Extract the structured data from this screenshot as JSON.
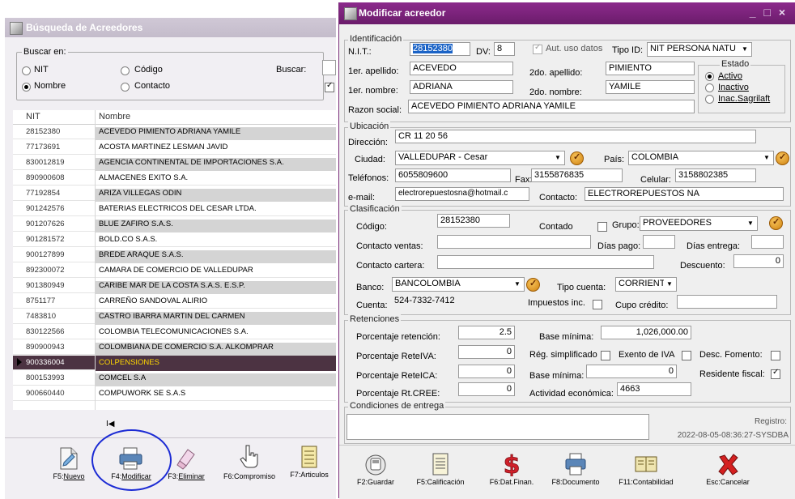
{
  "left_window": {
    "title": "Búsqueda de Acreedores",
    "search_in_label": "Buscar en:",
    "radio_nit": "NIT",
    "radio_codigo": "Código",
    "radio_nombre": "Nombre",
    "radio_contacto": "Contacto",
    "buscar_label": "Buscar:",
    "selected_radio": "Nombre",
    "columns": [
      "NIT",
      "Nombre"
    ],
    "rows": [
      {
        "nit": "28152380",
        "nombre": "ACEVEDO PIMIENTO ADRIANA YAMILE"
      },
      {
        "nit": "77173691",
        "nombre": "ACOSTA MARTINEZ LESMAN JAVID"
      },
      {
        "nit": "830012819",
        "nombre": "AGENCIA CONTINENTAL DE IMPORTACIONES S.A."
      },
      {
        "nit": "890900608",
        "nombre": "ALMACENES EXITO S.A."
      },
      {
        "nit": "77192854",
        "nombre": "ARIZA VILLEGAS ODIN"
      },
      {
        "nit": "901242576",
        "nombre": "BATERIAS ELECTRICOS DEL CESAR LTDA."
      },
      {
        "nit": "901207626",
        "nombre": "BLUE ZAFIRO S.A.S."
      },
      {
        "nit": "901281572",
        "nombre": "BOLD.CO S.A.S."
      },
      {
        "nit": "900127899",
        "nombre": "BREDE ARAQUE S.A.S."
      },
      {
        "nit": "892300072",
        "nombre": "CAMARA DE COMERCIO DE VALLEDUPAR"
      },
      {
        "nit": "901380949",
        "nombre": "CARIBE MAR DE LA COSTA S.A.S. E.S.P."
      },
      {
        "nit": "8751177",
        "nombre": "CARREÑO SANDOVAL ALIRIO"
      },
      {
        "nit": "7483810",
        "nombre": "CASTRO IBARRA MARTIN DEL CARMEN"
      },
      {
        "nit": "830122566",
        "nombre": "COLOMBIA TELECOMUNICACIONES S.A."
      },
      {
        "nit": "890900943",
        "nombre": "COLOMBIANA DE COMERCIO S.A.   ALKOMPRAR"
      },
      {
        "nit": "900336004",
        "nombre": "COLPENSIONES"
      },
      {
        "nit": "800153993",
        "nombre": "COMCEL S.A"
      },
      {
        "nit": "900660440",
        "nombre": "COMPUWORK SE  S.A.S"
      }
    ],
    "selected_row_index": 15,
    "nav_glyph": "I◀",
    "toolbar": [
      {
        "key": "F5:",
        "label": "Nuevo",
        "icon": "new-document-icon"
      },
      {
        "key": "F4:",
        "label": "Modificar",
        "icon": "printer-edit-icon"
      },
      {
        "key": "F3:",
        "label": "Eliminar",
        "icon": "eraser-icon"
      },
      {
        "key": "F6:",
        "label": "Compromiso",
        "icon": "hand-pointer-icon"
      },
      {
        "key": "F7:",
        "label": "Articulos",
        "icon": "articles-list-icon"
      }
    ]
  },
  "right_window": {
    "title": "Modificar acreedor",
    "window_buttons": "_ □ ×",
    "identificacion": {
      "legend": "Identificación",
      "nit_label": "N.I.T.:",
      "nit": "28152380",
      "dv_label": "DV:",
      "dv": "8",
      "aut_label": "Aut. uso datos",
      "tipo_id_label": "Tipo ID:",
      "tipo_id": "NIT PERSONA NATU",
      "apellido1_label": "1er. apellido:",
      "apellido1": "ACEVEDO",
      "apellido2_label": "2do. apellido:",
      "apellido2": "PIMIENTO",
      "nombre1_label": "1er. nombre:",
      "nombre1": "ADRIANA",
      "nombre2_label": "2do. nombre:",
      "nombre2": "YAMILE",
      "razon_label": "Razon social:",
      "razon": "ACEVEDO PIMIENTO ADRIANA YAMILE",
      "estado_legend": "Estado",
      "estado_activo": "Activo",
      "estado_inactivo": "Inactivo",
      "estado_inac_sagrilaft": "Inac.Sagrilaft"
    },
    "ubicacion": {
      "legend": "Ubicación",
      "direccion_label": "Dirección:",
      "direccion": "CR 11 20 56",
      "ciudad_label": "Ciudad:",
      "ciudad": "VALLEDUPAR - Cesar",
      "pais_label": "País:",
      "pais": "COLOMBIA",
      "telefonos_label": "Teléfonos:",
      "telefonos": "6055809600",
      "fax_label": "Fax:",
      "fax": "3155876835",
      "celular_label": "Celular:",
      "celular": "3158802385",
      "email_label": "e-mail:",
      "email": "electrorepuestosna@hotmail.c",
      "contacto_label": "Contacto:",
      "contacto": "ELECTROREPUESTOS NA"
    },
    "clasificacion": {
      "legend": "Clasificación",
      "codigo_label": "Código:",
      "codigo": "28152380",
      "contado_label": "Contado",
      "grupo_label": "Grupo:",
      "grupo": "PROVEEDORES",
      "contacto_ventas_label": "Contacto ventas:",
      "dias_pago_label": "Días pago:",
      "dias_entrega_label": "Días entrega:",
      "contacto_cartera_label": "Contacto cartera:",
      "descuento_label": "Descuento:",
      "descuento": "0",
      "banco_label": "Banco:",
      "banco": "BANCOLOMBIA",
      "tipo_cuenta_label": "Tipo cuenta:",
      "tipo_cuenta": "CORRIENTE",
      "cuenta_label": "Cuenta:",
      "cuenta": "524-7332-7412",
      "impuestos_inc_label": "Impuestos inc.",
      "cupo_credito_label": "Cupo crédito:"
    },
    "retenciones": {
      "legend": "Retenciones",
      "porc_retencion_label": "Porcentaje retención:",
      "porc_retencion": "2.5",
      "base_minima_label": "Base mínima:",
      "base_minima": "1,026,000.00",
      "porc_reteiva_label": "Porcentaje ReteIVA:",
      "porc_reteiva": "0",
      "reg_simplificado_label": "Rég. simplificado",
      "exento_iva_label": "Exento de IVA",
      "desc_fomento_label": "Desc. Fomento:",
      "porc_reteica_label": "Porcentaje ReteICA:",
      "porc_reteica": "0",
      "base_minima2_label": "Base mínima:",
      "base_minima2": "0",
      "residente_label": "Residente fiscal:",
      "porc_rtcree_label": "Porcentaje Rt.CREE:",
      "porc_rtcree": "0",
      "actividad_label": "Actividad económica:",
      "actividad": "4663"
    },
    "condiciones": {
      "legend": "Condiciones de entrega",
      "registro_label": "Registro:",
      "registro": "2022-08-05-08:36:27-SYSDBA"
    },
    "toolbar": [
      {
        "label": "F2:Guardar",
        "icon": "save-icon"
      },
      {
        "label": "F5:Calificación",
        "icon": "document-icon"
      },
      {
        "label": "F6:Dat.Finan.",
        "icon": "dollar-icon"
      },
      {
        "label": "F8:Documento",
        "icon": "printer-icon"
      },
      {
        "label": "F11:Contabilidad",
        "icon": "ledger-icon"
      },
      {
        "label": "Esc:Cancelar",
        "icon": "cancel-x-icon"
      }
    ]
  },
  "colors": {
    "title_active": "#7c237c",
    "selected_row": "#4c3342",
    "selected_text": "#ffd800",
    "highlight_ellipse": "#1c2bd4"
  }
}
